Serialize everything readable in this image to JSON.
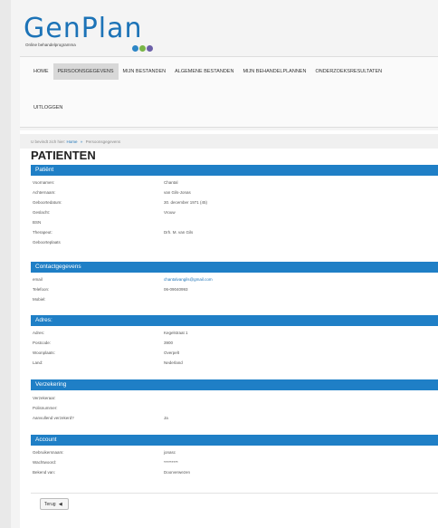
{
  "logo": {
    "text": "GenPlan",
    "tagline": "Online behandelprogramma",
    "dot_colors": [
      "#2d86c6",
      "#7ab648",
      "#6b5fa8"
    ]
  },
  "nav": {
    "items": [
      {
        "label": "HOME",
        "active": false
      },
      {
        "label": "PERSOONSGEGEVENS",
        "active": true
      },
      {
        "label": "MIJN BESTANDEN",
        "active": false
      },
      {
        "label": "ALGEMENE BESTANDEN",
        "active": false
      },
      {
        "label": "MIJN BEHANDELPLANNEN",
        "active": false
      },
      {
        "label": "ONDERZOEKSRESULTATEN",
        "active": false
      }
    ],
    "logout": "UITLOGGEN"
  },
  "breadcrumb": {
    "prefix": "U bevindt zich hier:",
    "home": "Home",
    "separator": "»",
    "current": "Persoonsgegevens"
  },
  "page_title": "PATIENTEN",
  "sections": [
    {
      "title": "Patiënt",
      "rows": [
        {
          "label": "Voornamen:",
          "value": "Chantal"
        },
        {
          "label": "Achternaam:",
          "value": "van Gils-Jonas"
        },
        {
          "label": "Geboortedatum:",
          "value": "30. december 1971 (45)"
        },
        {
          "label": "Geslacht:",
          "value": "Vrouw"
        },
        {
          "label": "BSN",
          "value": ""
        },
        {
          "label": "Therapeut:",
          "value": "Drh. M. van Gils"
        },
        {
          "label": "Geboorteplaats",
          "value": ""
        }
      ]
    },
    {
      "title": "Contactgegevens",
      "rows": [
        {
          "label": "email",
          "value": "chantalvangils@gmail.com",
          "link": true
        },
        {
          "label": "Telefoon:",
          "value": "06-09040993"
        },
        {
          "label": "Mobiel:",
          "value": ""
        }
      ]
    },
    {
      "title": "Adres:",
      "rows": [
        {
          "label": "Adres:",
          "value": "Kegelstraat 1"
        },
        {
          "label": "Postcode:",
          "value": "3900"
        },
        {
          "label": "Woonplaats:",
          "value": "Overpelt"
        },
        {
          "label": "Land:",
          "value": "Nederland"
        }
      ]
    },
    {
      "title": "Verzekering",
      "rows": [
        {
          "label": "Verzekeraar:",
          "value": ""
        },
        {
          "label": "Polisnummer:",
          "value": ""
        },
        {
          "label": "Aanvullend verzekerd?",
          "value": "Ja"
        }
      ]
    },
    {
      "title": "Account",
      "rows": [
        {
          "label": "Gebruikersnaam:",
          "value": "jonasc"
        },
        {
          "label": "Wachtwoord:",
          "value": "*********"
        },
        {
          "label": "Bekend van:",
          "value": "Doorverwezen"
        }
      ]
    }
  ],
  "back_button": {
    "label": "Terug",
    "arrow": "◀"
  }
}
